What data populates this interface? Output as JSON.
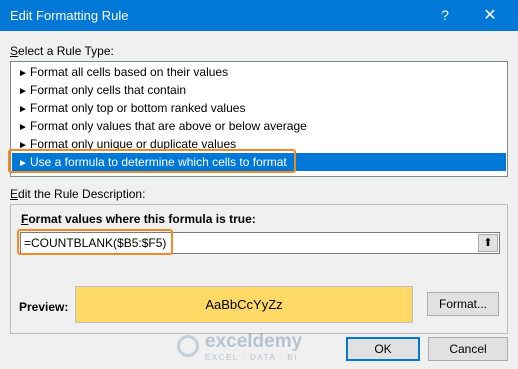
{
  "window": {
    "title": "Edit Formatting Rule",
    "help_glyph": "?",
    "close_glyph": "✕"
  },
  "rule_type": {
    "label_first": "S",
    "label_rest": "elect a Rule Type:",
    "arrow_glyph": "►",
    "items": [
      "Format all cells based on their values",
      "Format only cells that contain",
      "Format only top or bottom ranked values",
      "Format only values that are above or below average",
      "Format only unique or duplicate values",
      "Use a formula to determine which cells to format"
    ],
    "selected_index": 5
  },
  "description": {
    "label_first": "E",
    "label_rest": "dit the Rule Description:",
    "formula_label_first": "F",
    "formula_label_rest": "ormat values where this formula is true:",
    "formula_value": "=COUNTBLANK($B5:$F5)",
    "collapse_glyph": "⬆",
    "preview_label": "Preview:",
    "preview_text": "AaBbCcYyZz",
    "preview_fill": "#ffd966",
    "format_button": "Format..."
  },
  "buttons": {
    "ok": "OK",
    "cancel": "Cancel"
  },
  "watermark": {
    "name": "exceldemy",
    "tagline": "EXCEL · DATA · BI"
  },
  "colors": {
    "titlebar": "#0078d7",
    "selection": "#0078d7",
    "highlight_box": "#f08a24"
  }
}
